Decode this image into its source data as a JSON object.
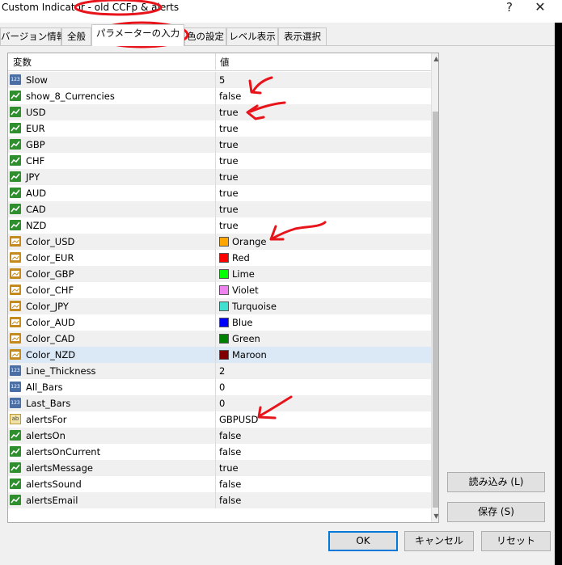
{
  "window": {
    "title_prefix": "Custom Indicator - ",
    "title_name": "old CCFp & alerts",
    "help_icon": "?",
    "close_icon": "✕"
  },
  "tabs": [
    {
      "label": "バージョン情報"
    },
    {
      "label": "全般"
    },
    {
      "label": "パラメーターの入力"
    },
    {
      "label": "色の設定"
    },
    {
      "label": "レベル表示"
    },
    {
      "label": "表示選択"
    }
  ],
  "grid": {
    "headers": {
      "variable": "変数",
      "value": "値"
    },
    "rows": [
      {
        "type": "int",
        "name": "Slow",
        "value": "5"
      },
      {
        "type": "bool",
        "name": "show_8_Currencies",
        "value": "false"
      },
      {
        "type": "bool",
        "name": "USD",
        "value": "true"
      },
      {
        "type": "bool",
        "name": "EUR",
        "value": "true"
      },
      {
        "type": "bool",
        "name": "GBP",
        "value": "true"
      },
      {
        "type": "bool",
        "name": "CHF",
        "value": "true"
      },
      {
        "type": "bool",
        "name": "JPY",
        "value": "true"
      },
      {
        "type": "bool",
        "name": "AUD",
        "value": "true"
      },
      {
        "type": "bool",
        "name": "CAD",
        "value": "true"
      },
      {
        "type": "bool",
        "name": "NZD",
        "value": "true"
      },
      {
        "type": "color",
        "name": "Color_USD",
        "value": "Orange",
        "color": "#ffa500"
      },
      {
        "type": "color",
        "name": "Color_EUR",
        "value": "Red",
        "color": "#ff0000"
      },
      {
        "type": "color",
        "name": "Color_GBP",
        "value": "Lime",
        "color": "#00ff00"
      },
      {
        "type": "color",
        "name": "Color_CHF",
        "value": "Violet",
        "color": "#ee82ee"
      },
      {
        "type": "color",
        "name": "Color_JPY",
        "value": "Turquoise",
        "color": "#40e0d0"
      },
      {
        "type": "color",
        "name": "Color_AUD",
        "value": "Blue",
        "color": "#0000ff"
      },
      {
        "type": "color",
        "name": "Color_CAD",
        "value": "Green",
        "color": "#008000"
      },
      {
        "type": "color",
        "name": "Color_NZD",
        "value": "Maroon",
        "color": "#800000"
      },
      {
        "type": "int",
        "name": "Line_Thickness",
        "value": "2"
      },
      {
        "type": "int",
        "name": "All_Bars",
        "value": "0"
      },
      {
        "type": "int",
        "name": "Last_Bars",
        "value": "0"
      },
      {
        "type": "string",
        "name": "alertsFor",
        "value": "GBPUSD"
      },
      {
        "type": "bool",
        "name": "alertsOn",
        "value": "false"
      },
      {
        "type": "bool",
        "name": "alertsOnCurrent",
        "value": "false"
      },
      {
        "type": "bool",
        "name": "alertsMessage",
        "value": "true"
      },
      {
        "type": "bool",
        "name": "alertsSound",
        "value": "false"
      },
      {
        "type": "bool",
        "name": "alertsEmail",
        "value": "false"
      }
    ],
    "type_icons": {
      "int": "123",
      "string": "ab"
    }
  },
  "buttons": {
    "load": "読み込み (L)",
    "save": "保存 (S)",
    "ok": "OK",
    "cancel": "キャンセル",
    "reset": "リセット"
  },
  "colors": {
    "annotation": "#e8141b",
    "selection": "#dbe9f7",
    "accent": "#0078d7"
  }
}
